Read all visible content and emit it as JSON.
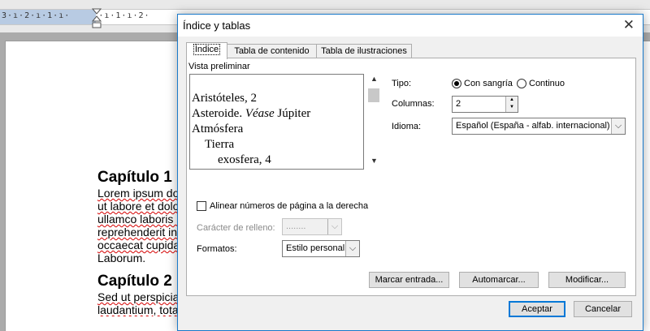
{
  "word": {
    "ruler_ticks": "3·ı·2·ı·1·ı·     ·ı·1·ı·2·",
    "doc_lines": [
      {
        "type": "heading",
        "text": "Capítulo 1"
      },
      {
        "type": "text",
        "text": "Lorem ipsum do",
        "squiggle": true
      },
      {
        "type": "text",
        "text": "ut labore et dolo",
        "squiggle": true
      },
      {
        "type": "text",
        "text": "ullamco laboris n",
        "squiggle": true
      },
      {
        "type": "text",
        "text": "reprehenderit in",
        "squiggle": true
      },
      {
        "type": "text",
        "text": "occaecat cupida",
        "squiggle": true
      },
      {
        "type": "text",
        "text": "Laborum.",
        "squiggle": false
      },
      {
        "type": "gap"
      },
      {
        "type": "heading",
        "text": "Capítulo 2"
      },
      {
        "type": "text",
        "text": "Sed ut perspicia",
        "squiggle": true
      },
      {
        "type": "text",
        "text": "laudantium, totam rem aperiam, eaque ipsa quae ab illo inventore veritatis et quasi",
        "squiggle": true
      }
    ]
  },
  "dialog": {
    "title": "Índice y tablas",
    "close_label": "✕",
    "tabs": [
      {
        "label": "Índice",
        "active": true
      },
      {
        "label": "Tabla de contenido",
        "active": false
      },
      {
        "label": "Tabla de ilustraciones",
        "active": false
      }
    ],
    "preview": {
      "label": "Vista preliminar",
      "lines": [
        {
          "text": "Aristóteles, 2"
        },
        {
          "prefix": "Asteroide. ",
          "italic": "Véase",
          "suffix": " Júpiter"
        },
        {
          "text": "Atmósfera"
        },
        {
          "text": "Tierra"
        },
        {
          "text": "exosfera, 4"
        }
      ]
    },
    "tipo": {
      "label": "Tipo:",
      "options": [
        {
          "label": "Con sangría",
          "checked": true
        },
        {
          "label": "Continuo",
          "checked": false
        }
      ]
    },
    "columnas": {
      "label": "Columnas:",
      "value": "2"
    },
    "idioma": {
      "label": "Idioma:",
      "value": "Español (España - alfab. internacional)"
    },
    "align_right": {
      "label": "Alinear números de página a la derecha",
      "checked": false
    },
    "relleno": {
      "label": "Carácter de relleno:",
      "value": "........"
    },
    "formatos": {
      "label": "Formatos:",
      "value": "Estilo personal"
    },
    "buttons": {
      "marcar": "Marcar entrada...",
      "automarcar": "Automarcar...",
      "modificar": "Modificar...",
      "aceptar": "Aceptar",
      "cancelar": "Cancelar"
    },
    "colors": {
      "title_border": "#1979ca",
      "default_button": "#0078d7"
    }
  }
}
